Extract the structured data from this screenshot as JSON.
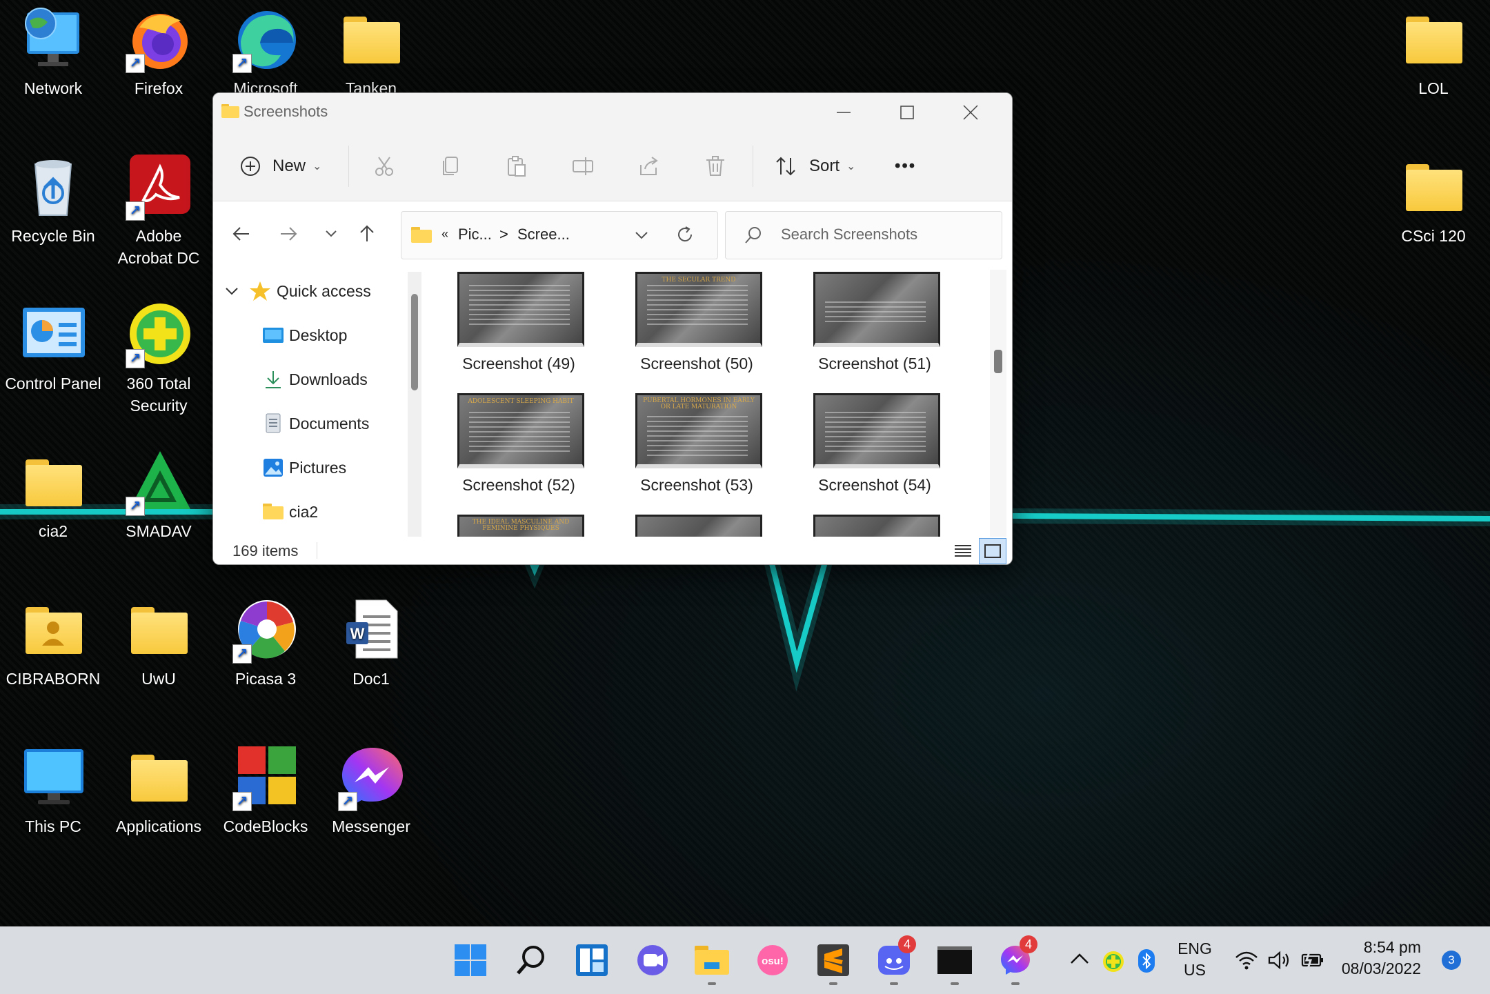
{
  "desktop": {
    "icons": [
      {
        "label": "Network"
      },
      {
        "label": "Firefox"
      },
      {
        "label": "Microsoft"
      },
      {
        "label": "Tanken"
      },
      {
        "label": "LOL"
      },
      {
        "label": "Recycle Bin"
      },
      {
        "label": "Adobe\nAcrobat DC"
      },
      {
        "label": "CSci 120"
      },
      {
        "label": "Control Panel"
      },
      {
        "label": "360 Total\nSecurity"
      },
      {
        "label": "cia2"
      },
      {
        "label": "SMADAV"
      },
      {
        "label": "CIBRABORN"
      },
      {
        "label": "UwU"
      },
      {
        "label": "Picasa 3"
      },
      {
        "label": "Doc1"
      },
      {
        "label": "This PC"
      },
      {
        "label": "Applications"
      },
      {
        "label": "CodeBlocks"
      },
      {
        "label": "Messenger"
      }
    ]
  },
  "explorer": {
    "title": "Screenshots",
    "toolbar": {
      "new_label": "New",
      "sort_label": "Sort",
      "more": "•••"
    },
    "address": {
      "chevron": "«",
      "seg1": "Pic...",
      "sep": ">",
      "seg2": "Scree..."
    },
    "search_placeholder": "Search Screenshots",
    "nav": {
      "quick_access": "Quick access",
      "items": [
        "Desktop",
        "Downloads",
        "Documents",
        "Pictures",
        "cia2"
      ]
    },
    "files": [
      {
        "name": "Screenshot (49)",
        "heading": ""
      },
      {
        "name": "Screenshot (50)",
        "heading": "THE SECULAR TREND"
      },
      {
        "name": "Screenshot (51)",
        "heading": ""
      },
      {
        "name": "Screenshot (52)",
        "heading": "ADOLESCENT SLEEPING HABIT"
      },
      {
        "name": "Screenshot (53)",
        "heading": "PUBERTAL HORMONES IN EARLY\nOR LATE MATURATION"
      },
      {
        "name": "Screenshot (54)",
        "heading": ""
      }
    ],
    "partial_row_heading": "THE IDEAL MASCULINE AND\nFEMININE PHYSIQUES",
    "status": "169 items"
  },
  "taskbar": {
    "discord_badge": "4",
    "messenger_badge": "4",
    "osu_label": "osu!",
    "lang": "ENG",
    "region": "US",
    "time": "8:54 pm",
    "date": "08/03/2022",
    "notifications": "3"
  },
  "colors": {
    "accent": "#1a73e8",
    "pulse": "#19e6e0",
    "taskbar": "#d9dde2"
  }
}
